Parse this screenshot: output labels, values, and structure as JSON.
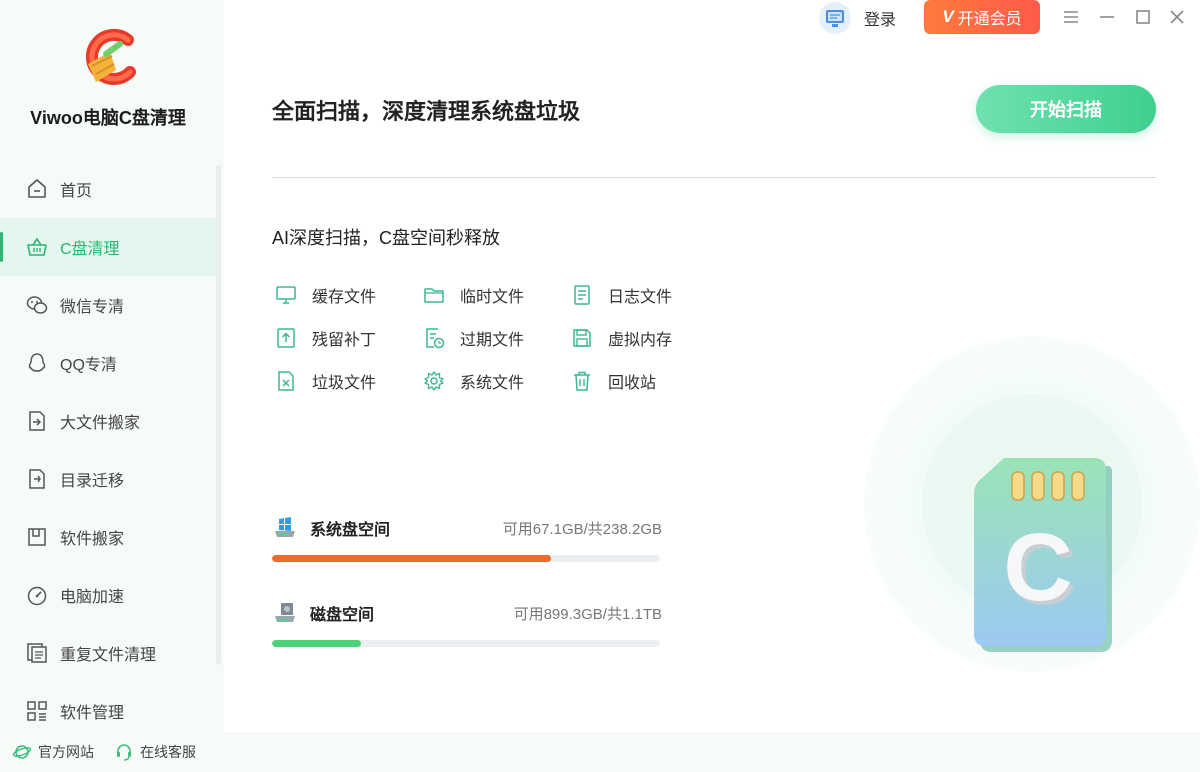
{
  "app": {
    "name": "Viwoo电脑C盘清理"
  },
  "sidebar": {
    "items": [
      {
        "label": "首页",
        "icon": "home-icon",
        "active": false
      },
      {
        "label": "C盘清理",
        "icon": "basket-icon",
        "active": true
      },
      {
        "label": "微信专清",
        "icon": "wechat-icon",
        "active": false
      },
      {
        "label": "QQ专清",
        "icon": "qq-icon",
        "active": false
      },
      {
        "label": "大文件搬家",
        "icon": "file-move-icon",
        "active": false
      },
      {
        "label": "目录迁移",
        "icon": "folder-migrate-icon",
        "active": false
      },
      {
        "label": "软件搬家",
        "icon": "software-move-icon",
        "active": false
      },
      {
        "label": "电脑加速",
        "icon": "speedometer-icon",
        "active": false
      },
      {
        "label": "重复文件清理",
        "icon": "duplicate-file-icon",
        "active": false
      },
      {
        "label": "软件管理",
        "icon": "apps-grid-icon",
        "active": false
      }
    ]
  },
  "footer": {
    "website": "官方网站",
    "support": "在线客服"
  },
  "topbar": {
    "login": "登录",
    "vip": "开通会员",
    "vip_mark": "V"
  },
  "main": {
    "headline": "全面扫描，深度清理系统盘垃圾",
    "scan_button": "开始扫描",
    "subheadline": "AI深度扫描，C盘空间秒释放",
    "file_types": [
      {
        "label": "缓存文件",
        "icon": "monitor-icon"
      },
      {
        "label": "临时文件",
        "icon": "folder-icon"
      },
      {
        "label": "日志文件",
        "icon": "document-icon"
      },
      {
        "label": "残留补丁",
        "icon": "patch-icon"
      },
      {
        "label": "过期文件",
        "icon": "expired-file-icon"
      },
      {
        "label": "虚拟内存",
        "icon": "save-disk-icon"
      },
      {
        "label": "垃圾文件",
        "icon": "junk-file-icon"
      },
      {
        "label": "系统文件",
        "icon": "gear-icon"
      },
      {
        "label": "回收站",
        "icon": "trash-icon"
      }
    ],
    "disks": [
      {
        "title": "系统盘空间",
        "info": "可用67.1GB/共238.2GB",
        "used_fraction": 0.718,
        "color": "#f06a2e"
      },
      {
        "title": "磁盘空间",
        "info": "可用899.3GB/共1.1TB",
        "used_fraction": 0.23,
        "color": "#4cd37a"
      }
    ],
    "illustration_letter": "C"
  },
  "colors": {
    "accent": "#2bb673",
    "vip": "#ff6a40"
  }
}
